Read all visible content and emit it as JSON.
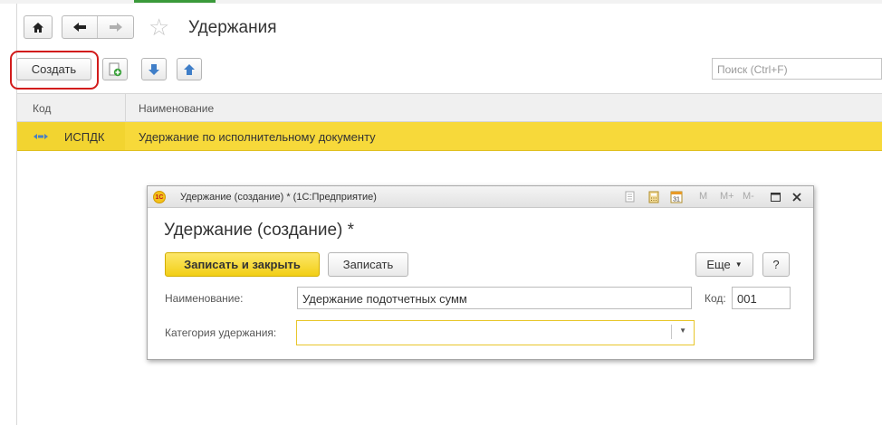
{
  "window": {
    "title": "Удержания"
  },
  "toolbar": {
    "create_label": "Создать",
    "search_placeholder": "Поиск (Ctrl+F)"
  },
  "grid": {
    "columns": [
      "Код",
      "Наименование"
    ],
    "rows": [
      {
        "code": "ИСПДК",
        "name": "Удержание по исполнительному документу",
        "selected": true
      }
    ]
  },
  "dialog": {
    "window_title": "Удержание (создание) * (1С:Предприятие)",
    "logo_text": "1С",
    "titlebar_icons": [
      "document-icon",
      "calculator-icon",
      "calendar-icon",
      "memory-m-icon",
      "memory-m-plus-icon",
      "memory-m-minus-icon",
      "maximize-icon",
      "close-icon"
    ],
    "memory_labels": [
      "M",
      "M+",
      "M-"
    ],
    "heading": "Удержание (создание) *",
    "save_close_label": "Записать и закрыть",
    "save_label": "Записать",
    "more_label": "Еще",
    "help_label": "?",
    "name_label": "Наименование:",
    "name_value": "Удержание подотчетных сумм",
    "code_label": "Код:",
    "code_value": "001",
    "category_label": "Категория удержания:",
    "category_value": ""
  },
  "colors": {
    "accent_yellow": "#f7d93a",
    "highlight_red": "#d21c1c"
  }
}
